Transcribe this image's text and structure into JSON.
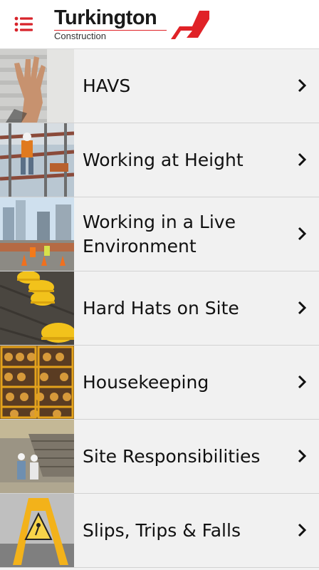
{
  "header": {
    "menu_icon": "hamburger-icon",
    "logo_name": "Turkington",
    "logo_subtitle": "Construction",
    "brand_color": "#e02227"
  },
  "topics": [
    {
      "label": "HAVS",
      "thumbnail": "hand-photo"
    },
    {
      "label": "Working at Height",
      "thumbnail": "scaffold-worker-photo"
    },
    {
      "label": "Working in a Live Environment",
      "thumbnail": "street-works-photo"
    },
    {
      "label": "Hard Hats on Site",
      "thumbnail": "hard-hats-photo"
    },
    {
      "label": "Housekeeping",
      "thumbnail": "storage-cage-photo"
    },
    {
      "label": "Site Responsibilities",
      "thumbnail": "site-excavation-photo"
    },
    {
      "label": "Slips, Trips & Falls",
      "thumbnail": "wet-floor-sign-photo"
    }
  ],
  "row_icon": "chevron-right-icon"
}
